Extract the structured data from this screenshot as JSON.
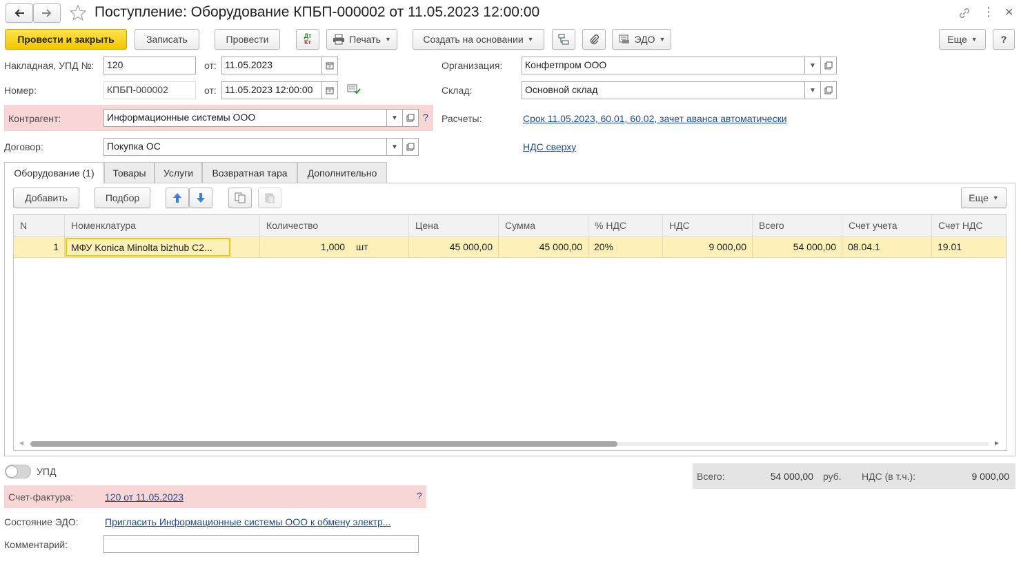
{
  "window": {
    "title": "Поступление: Оборудование КПБП-000002 от 11.05.2023 12:00:00"
  },
  "toolbar": {
    "post_close": "Провести и закрыть",
    "save": "Записать",
    "post": "Провести",
    "dtkt_top": "Дт",
    "dtkt_bottom": "Кт",
    "print": "Печать",
    "create_based": "Создать на основании",
    "edo": "ЭДО",
    "more": "Еще",
    "help": "?"
  },
  "header": {
    "invoice_label": "Накладная, УПД №:",
    "invoice_value": "120",
    "from_label": "от:",
    "invoice_date": "11.05.2023",
    "number_label": "Номер:",
    "number_value": "КПБП-000002",
    "from_label2": "от:",
    "number_datetime": "11.05.2023 12:00:00",
    "counterparty_label": "Контрагент:",
    "counterparty_value": "Информационные системы ООО",
    "counterparty_help": "?",
    "contract_label": "Договор:",
    "contract_value": "Покупка ОС",
    "org_label": "Организация:",
    "org_value": "Конфетпром ООО",
    "warehouse_label": "Склад:",
    "warehouse_value": "Основной склад",
    "settlements_label": "Расчеты:",
    "settlements_link": "Срок 11.05.2023, 60.01, 60.02, зачет аванса автоматически",
    "vat_link": "НДС сверху"
  },
  "tabs": [
    {
      "label": "Оборудование (1)",
      "active": true
    },
    {
      "label": "Товары",
      "active": false
    },
    {
      "label": "Услуги",
      "active": false
    },
    {
      "label": "Возвратная тара",
      "active": false
    },
    {
      "label": "Дополнительно",
      "active": false
    }
  ],
  "table_toolbar": {
    "add": "Добавить",
    "pick": "Подбор",
    "more": "Еще"
  },
  "table": {
    "columns": [
      "N",
      "Номенклатура",
      "Количество",
      "Цена",
      "Сумма",
      "% НДС",
      "НДС",
      "Всего",
      "Счет учета",
      "Счет НДС"
    ],
    "rows": [
      {
        "n": "1",
        "item": "МФУ Konica Minolta bizhub C2...",
        "qty": "1,000",
        "unit": "шт",
        "price": "45 000,00",
        "sum": "45 000,00",
        "vat_rate": "20%",
        "vat": "9 000,00",
        "total": "54 000,00",
        "account": "08.04.1",
        "vat_account": "19.01"
      }
    ]
  },
  "footer": {
    "upd_label": "УПД",
    "upd_on": false,
    "invoice_label": "Счет-фактура:",
    "invoice_link": "120 от 11.05.2023",
    "invoice_help": "?",
    "edo_label": "Состояние ЭДО:",
    "edo_link": "Пригласить Информационные системы ООО к обмену электр...",
    "comment_label": "Комментарий:",
    "comment_value": "",
    "total_label": "Всего:",
    "total_value": "54 000,00",
    "currency": "руб.",
    "vat_incl_label": "НДС (в т.ч.):",
    "vat_incl_value": "9 000,00"
  },
  "colors": {
    "accent_yellow": "#f3c600",
    "required_pink": "#f9d6d6",
    "selected_row": "#fdf0b8",
    "link_blue": "#1a4c8f"
  }
}
